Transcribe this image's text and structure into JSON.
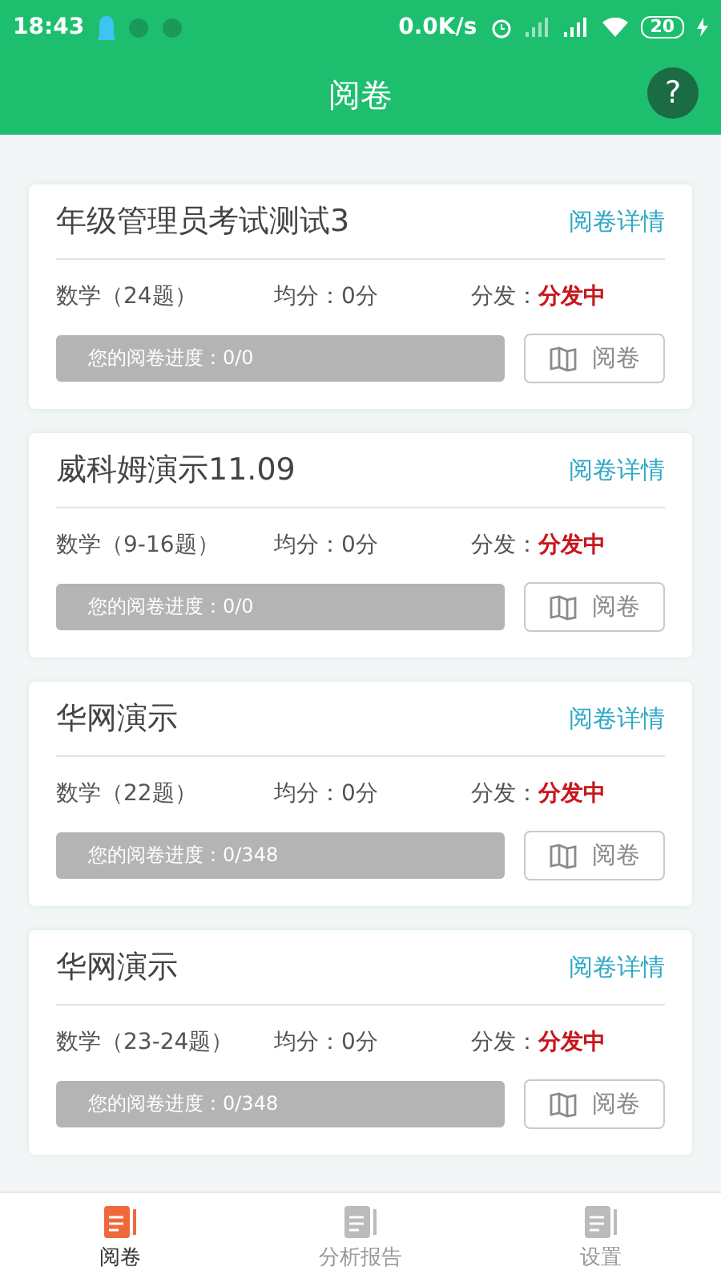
{
  "status_bar": {
    "time": "18:43",
    "speed": "0.0K/s",
    "battery": "20"
  },
  "header": {
    "title": "阅卷",
    "help": "?"
  },
  "exams": [
    {
      "title": "年级管理员考试测试3",
      "details": "阅卷详情",
      "subject": "数学（24题）",
      "average": "均分：0分",
      "dist_label": "分发：",
      "dist_status": "分发中",
      "progress": "您的阅卷进度：0/0",
      "level": 0,
      "action": "阅卷",
      "disabled": true
    },
    {
      "title": "威科姆演示11.09",
      "details": "阅卷详情",
      "subject": "数学（9-16题）",
      "average": "均分：0分",
      "dist_label": "分发：",
      "dist_status": "分发中",
      "progress": "您的阅卷进度：0/0",
      "level": 0,
      "action": "阅卷",
      "disabled": true
    },
    {
      "title": "华网演示",
      "details": "阅卷详情",
      "subject": "数学（22题）",
      "average": "均分：0分",
      "dist_label": "分发：",
      "dist_status": "分发中",
      "progress": "您的阅卷进度：0/348",
      "level": 0,
      "action": "阅卷",
      "disabled": true
    },
    {
      "title": "华网演示",
      "details": "阅卷详情",
      "subject": "数学（23-24题）",
      "average": "均分：0分",
      "dist_label": "分发：",
      "dist_status": "分发中",
      "progress": "您的阅卷进度：0/348",
      "level": 0,
      "action": "阅卷",
      "disabled": true
    }
  ],
  "tabs": [
    {
      "label": "阅卷",
      "selected": true
    },
    {
      "label": "分析报告",
      "selected": false
    },
    {
      "label": "设置",
      "selected": false
    }
  ]
}
